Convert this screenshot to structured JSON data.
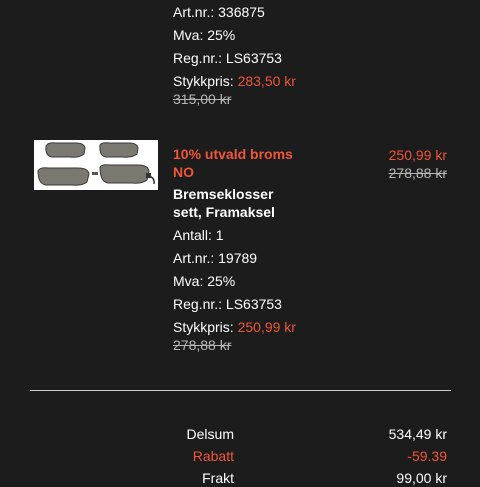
{
  "item1": {
    "art_label": "Art.nr.: 336875",
    "mva_label": "Mva: 25%",
    "reg_label": "Reg.nr.: LS63753",
    "unit_price_label": "Stykkpris:",
    "unit_price": "283,50 kr",
    "unit_price_old": "315,00 kr"
  },
  "item2": {
    "image_alt": "brake-pads-image",
    "promo_line1": "10% utvald broms",
    "promo_line2": "NO",
    "name_line1": "Bremseklosser",
    "name_line2": "sett, Framaksel",
    "qty_label": "Antall: 1",
    "art_label": "Art.nr.: 19789",
    "mva_label": "Mva: 25%",
    "reg_label": "Reg.nr.: LS63753",
    "unit_price_label": "Stykkpris:",
    "unit_price": "250,99 kr",
    "unit_price_old": "278,88 kr",
    "price": "250,99 kr",
    "price_old": "278,88 kr"
  },
  "summary": {
    "subtotal_label": "Delsum",
    "subtotal_value": "534,49 kr",
    "discount_label": "Rabatt",
    "discount_value": "-59.39",
    "shipping_label": "Frakt",
    "shipping_value": "99,00 kr"
  },
  "colors": {
    "background": "#1c1c1c",
    "accent_red": "#f0553a",
    "text": "#ffffff"
  }
}
